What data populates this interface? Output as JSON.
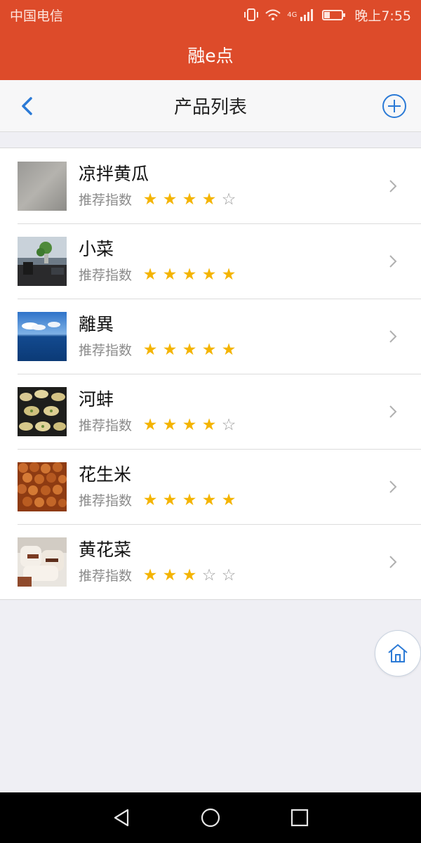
{
  "status_bar": {
    "carrier": "中国电信",
    "network": "4G",
    "time": "晚上7:55"
  },
  "app": {
    "title": "融e点"
  },
  "nav": {
    "title": "产品列表",
    "back_icon": "chevron-left-icon",
    "add_icon": "plus-circle-icon"
  },
  "products": {
    "rating_label": "推荐指数",
    "items": [
      {
        "name": "凉拌黄瓜",
        "rating": 4,
        "max": 5,
        "thumbnail": "gray-surface"
      },
      {
        "name": "小菜",
        "rating": 5,
        "max": 5,
        "thumbnail": "desk-with-plant"
      },
      {
        "name": "離異",
        "rating": 5,
        "max": 5,
        "thumbnail": "sea-and-sky"
      },
      {
        "name": "河蚌",
        "rating": 4,
        "max": 5,
        "thumbnail": "grilled-oysters"
      },
      {
        "name": "花生米",
        "rating": 5,
        "max": 5,
        "thumbnail": "peanuts"
      },
      {
        "name": "黄花菜",
        "rating": 3,
        "max": 5,
        "thumbnail": "rice-rolls"
      }
    ]
  },
  "colors": {
    "header": "#dd4b2a",
    "accent_blue": "#2b7ad6",
    "star_on": "#f4b400",
    "star_off": "#9a9a9a"
  },
  "home_icon": "home-icon",
  "system_nav": [
    "back-triangle-icon",
    "home-circle-icon",
    "recents-square-icon"
  ]
}
